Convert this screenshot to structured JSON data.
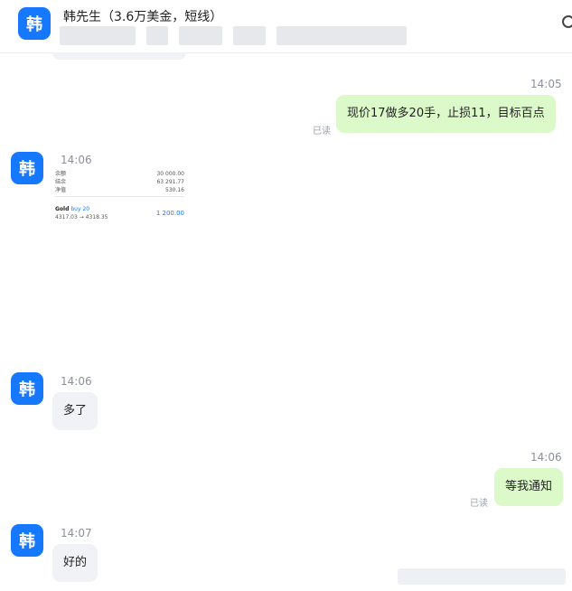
{
  "header": {
    "avatar_char": "韩",
    "title": "韩先生（3.6万美金，短线）"
  },
  "messages": [
    {
      "time": "14:05",
      "text": "现价17做多20手，止损11，目标百点",
      "read": "已读"
    },
    {
      "time": "14:06",
      "avatar_char": "韩"
    },
    {
      "time": "14:06",
      "avatar_char": "韩",
      "text": "多了"
    },
    {
      "time": "14:06",
      "text": "等我通知",
      "read": "已读"
    },
    {
      "time": "14:07",
      "avatar_char": "韩",
      "text": "好的"
    }
  ],
  "receipt": {
    "rows": [
      {
        "label": "余额",
        "value": "30 000.00"
      },
      {
        "label": "结余",
        "value": "63 291.77"
      },
      {
        "label": "净值",
        "value": "530.16"
      }
    ],
    "gold_label": "Gold",
    "buy_label": "buy 20",
    "price_line": "4317.03 → 4318.35",
    "amount": "1 200.00"
  }
}
